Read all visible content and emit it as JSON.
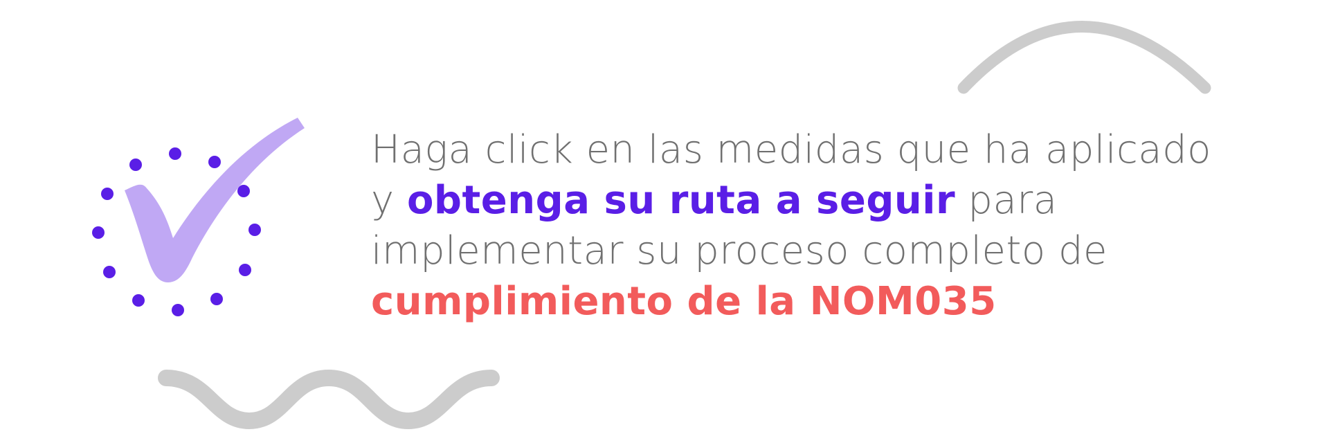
{
  "banner": {
    "lines": [
      {
        "parts": [
          {
            "text": "Haga click en las medidas que ha aplicado",
            "style": "normal"
          }
        ]
      },
      {
        "parts": [
          {
            "text": "y ",
            "style": "normal"
          },
          {
            "text": "obtenga su ruta a seguir",
            "style": "highlight-purple"
          },
          {
            "text": " para",
            "style": "normal"
          }
        ]
      },
      {
        "parts": [
          {
            "text": "implementar su proceso completo de",
            "style": "normal"
          }
        ]
      },
      {
        "parts": [
          {
            "text": "cumplimiento de la NOM035",
            "style": "highlight-red"
          }
        ]
      }
    ]
  },
  "decorations": {
    "checkmark_icon": "check-icon",
    "dots_ring": "dotted-circle",
    "arc": "gray-arc",
    "wave": "gray-wave"
  },
  "colors": {
    "text": "#707070",
    "highlight_purple": "#5a1ee6",
    "highlight_red": "#f25b5b",
    "check_fill": "#c0a8f4",
    "dots": "#5a1ee6",
    "decor_gray": "#cccccc",
    "background": "#ffffff"
  }
}
